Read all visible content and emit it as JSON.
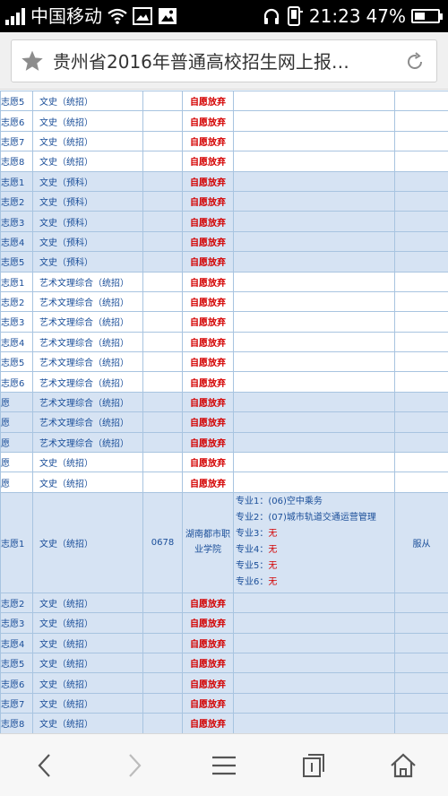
{
  "status_bar": {
    "carrier": "中国移动",
    "time": "21:23",
    "battery_text": "47%",
    "battery_level": 0.47,
    "icons": [
      "signal-icon",
      "wifi-icon",
      "image-icon",
      "gallery-icon",
      "headphones-icon",
      "phone-icon",
      "battery-icon"
    ]
  },
  "address_bar": {
    "title": "贵州省2016年普通高校招生网上报…",
    "icons": [
      "star-icon",
      "reload-icon"
    ]
  },
  "table": {
    "rows": [
      {
        "choice": "志愿5",
        "category": "文史（统招）",
        "code": "",
        "school": "",
        "status": "自愿放弃",
        "shade": "wht"
      },
      {
        "choice": "志愿6",
        "category": "文史（统招）",
        "code": "",
        "school": "",
        "status": "自愿放弃",
        "shade": "wht"
      },
      {
        "choice": "志愿7",
        "category": "文史（统招）",
        "code": "",
        "school": "",
        "status": "自愿放弃",
        "shade": "wht"
      },
      {
        "choice": "志愿8",
        "category": "文史（统招）",
        "code": "",
        "school": "",
        "status": "自愿放弃",
        "shade": "wht"
      },
      {
        "choice": "志愿1",
        "category": "文史（预科）",
        "code": "",
        "school": "",
        "status": "自愿放弃",
        "shade": "alt"
      },
      {
        "choice": "志愿2",
        "category": "文史（预科）",
        "code": "",
        "school": "",
        "status": "自愿放弃",
        "shade": "alt"
      },
      {
        "choice": "志愿3",
        "category": "文史（预科）",
        "code": "",
        "school": "",
        "status": "自愿放弃",
        "shade": "alt"
      },
      {
        "choice": "志愿4",
        "category": "文史（预科）",
        "code": "",
        "school": "",
        "status": "自愿放弃",
        "shade": "alt"
      },
      {
        "choice": "志愿5",
        "category": "文史（预科）",
        "code": "",
        "school": "",
        "status": "自愿放弃",
        "shade": "alt"
      },
      {
        "choice": "志愿1",
        "category": "艺术文理综合（统招）",
        "code": "",
        "school": "",
        "status": "自愿放弃",
        "shade": "wht"
      },
      {
        "choice": "志愿2",
        "category": "艺术文理综合（统招）",
        "code": "",
        "school": "",
        "status": "自愿放弃",
        "shade": "wht"
      },
      {
        "choice": "志愿3",
        "category": "艺术文理综合（统招）",
        "code": "",
        "school": "",
        "status": "自愿放弃",
        "shade": "wht"
      },
      {
        "choice": "志愿4",
        "category": "艺术文理综合（统招）",
        "code": "",
        "school": "",
        "status": "自愿放弃",
        "shade": "wht"
      },
      {
        "choice": "志愿5",
        "category": "艺术文理综合（统招）",
        "code": "",
        "school": "",
        "status": "自愿放弃",
        "shade": "wht"
      },
      {
        "choice": "志愿6",
        "category": "艺术文理综合（统招）",
        "code": "",
        "school": "",
        "status": "自愿放弃",
        "shade": "wht"
      },
      {
        "choice": "愿",
        "category": "艺术文理综合（统招）",
        "code": "",
        "school": "",
        "status": "自愿放弃",
        "shade": "alt"
      },
      {
        "choice": "愿",
        "category": "艺术文理综合（统招）",
        "code": "",
        "school": "",
        "status": "自愿放弃",
        "shade": "alt"
      },
      {
        "choice": "愿",
        "category": "艺术文理综合（统招）",
        "code": "",
        "school": "",
        "status": "自愿放弃",
        "shade": "alt"
      },
      {
        "choice": "愿",
        "category": "文史（统招）",
        "code": "",
        "school": "",
        "status": "自愿放弃",
        "shade": "wht"
      },
      {
        "choice": "愿",
        "category": "文史（统招）",
        "code": "",
        "school": "",
        "status": "自愿放弃",
        "shade": "wht"
      }
    ],
    "admitted_row": {
      "choice": "志愿1",
      "category": "文史（统招）",
      "code": "0678",
      "school": "湖南都市职业学院",
      "majors": [
        {
          "label": "专业1：",
          "value": "(06)空中乘务",
          "none": false
        },
        {
          "label": "专业2：",
          "value": "(07)城市轨道交通运营管理",
          "none": false
        },
        {
          "label": "专业3：",
          "value": "无",
          "none": true
        },
        {
          "label": "专业4：",
          "value": "无",
          "none": true
        },
        {
          "label": "专业5：",
          "value": "无",
          "none": true
        },
        {
          "label": "专业6：",
          "value": "无",
          "none": true
        }
      ],
      "adjust": "服从"
    },
    "rows_after": [
      {
        "choice": "志愿2",
        "category": "文史（统招）",
        "code": "",
        "school": "",
        "status": "自愿放弃",
        "shade": "alt"
      },
      {
        "choice": "志愿3",
        "category": "文史（统招）",
        "code": "",
        "school": "",
        "status": "自愿放弃",
        "shade": "alt"
      },
      {
        "choice": "志愿4",
        "category": "文史（统招）",
        "code": "",
        "school": "",
        "status": "自愿放弃",
        "shade": "alt"
      },
      {
        "choice": "志愿5",
        "category": "文史（统招）",
        "code": "",
        "school": "",
        "status": "自愿放弃",
        "shade": "alt"
      },
      {
        "choice": "志愿6",
        "category": "文史（统招）",
        "code": "",
        "school": "",
        "status": "自愿放弃",
        "shade": "alt"
      },
      {
        "choice": "志愿7",
        "category": "文史（统招）",
        "code": "",
        "school": "",
        "status": "自愿放弃",
        "shade": "alt"
      },
      {
        "choice": "志愿8",
        "category": "文史（统招）",
        "code": "",
        "school": "",
        "status": "自愿放弃",
        "shade": "alt"
      }
    ]
  },
  "bottom_nav": {
    "icons": [
      "back-icon",
      "forward-icon",
      "menu-icon",
      "tabs-icon",
      "home-icon"
    ]
  },
  "colors": {
    "cell_text": "#1a4e99",
    "status_red": "#d40000",
    "row_alt_bg": "#d6e3f3",
    "border": "#a8c4e0"
  }
}
